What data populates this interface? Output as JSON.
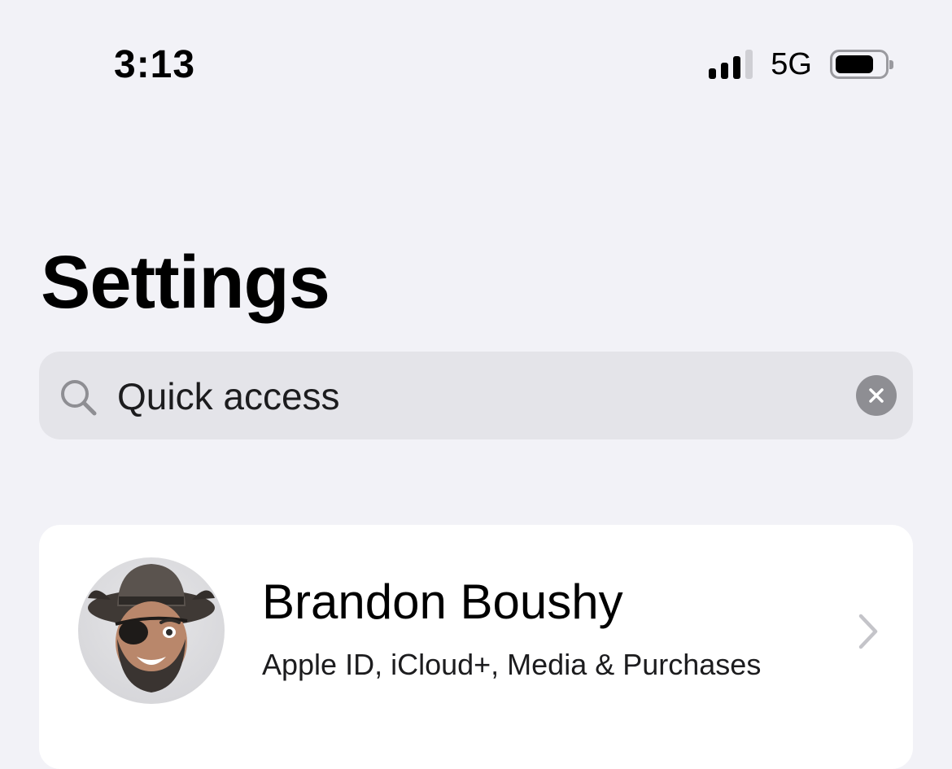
{
  "status_bar": {
    "time": "3:13",
    "network": "5G",
    "signal_bars_active": 3,
    "signal_bars_total": 4,
    "battery_level": 0.8,
    "icons": [
      "signal-icon",
      "battery-icon"
    ]
  },
  "header": {
    "title": "Settings"
  },
  "search": {
    "value": "Quick access",
    "icons": [
      "search-icon",
      "clear-icon"
    ]
  },
  "profile": {
    "name": "Brandon Boushy",
    "subtitle": "Apple ID, iCloud+, Media & Purchases",
    "icons": [
      "avatar-memoji",
      "chevron-right-icon"
    ]
  },
  "colors": {
    "background": "#f2f2f7",
    "search_background": "#e4e4e9",
    "card_background": "#ffffff",
    "secondary_gray": "#8e8e93"
  }
}
